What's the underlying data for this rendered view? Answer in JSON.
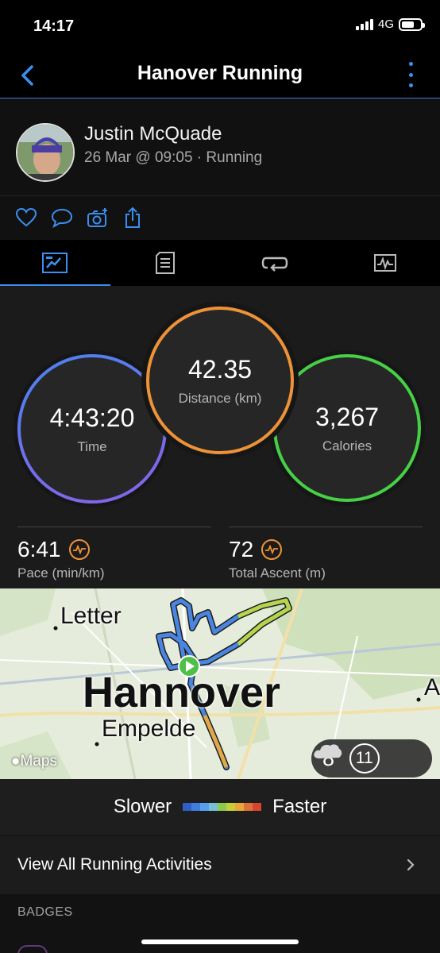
{
  "status_bar": {
    "time": "14:17",
    "network": "4G"
  },
  "header": {
    "title": "Hanover Running"
  },
  "profile": {
    "name": "Justin McQuade",
    "meta": "26 Mar @ 09:05 · Running"
  },
  "stats": {
    "time": {
      "value": "4:43:20",
      "label": "Time"
    },
    "distance": {
      "value": "42.35",
      "label": "Distance (km)"
    },
    "calories": {
      "value": "3,267",
      "label": "Calories"
    },
    "pace": {
      "value": "6:41",
      "label": "Pace (min/km)"
    },
    "ascent": {
      "value": "72",
      "label": "Total Ascent (m)"
    }
  },
  "map": {
    "labels": {
      "letter": "Letter",
      "city": "Hannover",
      "empelde": "Empelde",
      "edge": "A"
    },
    "attribution": "Maps",
    "weather": {
      "temperature": "8°",
      "icon": "cloud-icon",
      "wind": "11"
    }
  },
  "legend": {
    "slower": "Slower",
    "faster": "Faster",
    "colors": [
      "#2e5fc4",
      "#3f7ee0",
      "#58a0ea",
      "#78c0d8",
      "#8cc94c",
      "#c6cf3a",
      "#e8a838",
      "#e0703a",
      "#d9442e"
    ]
  },
  "links": {
    "view_all": "View All Running Activities"
  },
  "sections": {
    "badges": "BADGES"
  },
  "colors": {
    "accent": "#3b8ff0",
    "time_ring": "#4a83f0",
    "distance_ring": "#ee9238",
    "calories_ring": "#45d046"
  }
}
